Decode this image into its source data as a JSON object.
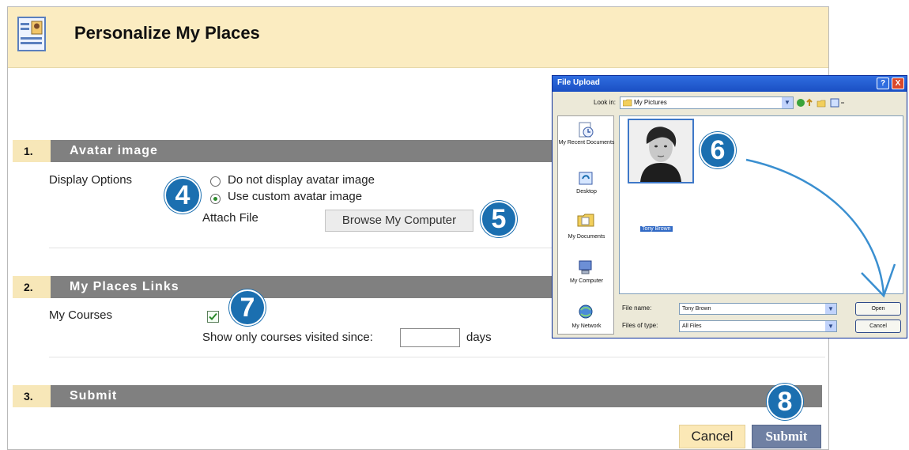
{
  "header": {
    "title": "Personalize My Places"
  },
  "sections": [
    {
      "number": "1.",
      "title": "Avatar image"
    },
    {
      "number": "2.",
      "title": "My Places Links"
    },
    {
      "number": "3.",
      "title": "Submit"
    }
  ],
  "avatar": {
    "display_options_label": "Display Options",
    "option_none": "Do not display avatar image",
    "option_custom": "Use custom avatar image",
    "selected_option": "Use custom avatar image",
    "attach_file_label": "Attach File",
    "browse_button": "Browse My Computer"
  },
  "links": {
    "my_courses_label": "My Courses",
    "my_courses_checked": true,
    "show_only_label": "Show only courses visited since:",
    "days_value": "",
    "days_label": "days"
  },
  "actions": {
    "cancel": "Cancel",
    "submit": "Submit"
  },
  "callouts": [
    "4",
    "5",
    "6",
    "7",
    "8"
  ],
  "dialog": {
    "title": "File Upload",
    "help_button": "?",
    "close_button": "X",
    "look_in_label": "Look in:",
    "look_in_value": "My Pictures",
    "places": [
      "My Recent Documents",
      "Desktop",
      "My Documents",
      "My Computer",
      "My Network"
    ],
    "file_item": "Tony Brown",
    "file_name_label": "File name:",
    "file_name_value": "Tony Brown",
    "files_of_type_label": "Files of type:",
    "files_of_type_value": "All Files",
    "open_button": "Open",
    "cancel_button": "Cancel"
  },
  "colors": {
    "header_bg": "#fbecc1",
    "section_bar": "#808080",
    "callout": "#1b6fb0",
    "submit_bg": "#6f80a3",
    "cancel_bg": "#fbe8b6"
  }
}
